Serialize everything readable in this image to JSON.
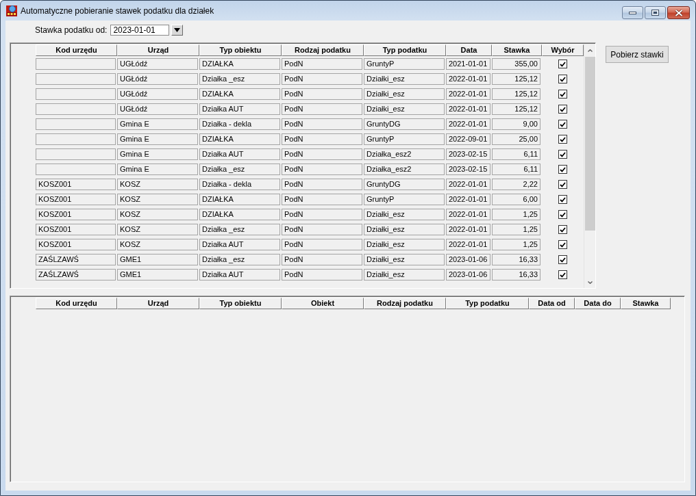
{
  "window": {
    "title": "Automatyczne pobieranie stawek podatku dla działek"
  },
  "filter": {
    "label": "Stawka podatku od:",
    "value": "2023-01-01"
  },
  "rates_table": {
    "columns": [
      "Kod urzędu",
      "Urząd",
      "Typ obiektu",
      "Rodzaj podatku",
      "Typ podatku",
      "Data",
      "Stawka",
      "Wybór"
    ],
    "rows": [
      {
        "office": "UGŁódź",
        "object_type": "DZIAŁKA",
        "tax_kind": "PodN",
        "tax_type": "GruntyP",
        "date": "2021-01-01",
        "rate": "355,00",
        "checked": true
      },
      {
        "office": "UGŁódź",
        "object_type": "Działka _esz",
        "tax_kind": "PodN",
        "tax_type": "Działki_esz",
        "date": "2022-01-01",
        "rate": "125,12",
        "checked": true
      },
      {
        "office": "UGŁódź",
        "object_type": "DZIAŁKA",
        "tax_kind": "PodN",
        "tax_type": "Działki_esz",
        "date": "2022-01-01",
        "rate": "125,12",
        "checked": true
      },
      {
        "office": "UGŁódź",
        "object_type": "Działka AUT",
        "tax_kind": "PodN",
        "tax_type": "Działki_esz",
        "date": "2022-01-01",
        "rate": "125,12",
        "checked": true
      },
      {
        "office": "Gmina E",
        "object_type": "Działka - dekla",
        "tax_kind": "PodN",
        "tax_type": "GruntyDG",
        "date": "2022-01-01",
        "rate": "9,00",
        "checked": true
      },
      {
        "office": "Gmina E",
        "object_type": "DZIAŁKA",
        "tax_kind": "PodN",
        "tax_type": "GruntyP",
        "date": "2022-09-01",
        "rate": "25,00",
        "checked": true
      },
      {
        "office": "Gmina E",
        "object_type": "Działka AUT",
        "tax_kind": "PodN",
        "tax_type": "Działka_esz2",
        "date": "2023-02-15",
        "rate": "6,11",
        "checked": true
      },
      {
        "office": "Gmina E",
        "object_type": "Działka _esz",
        "tax_kind": "PodN",
        "tax_type": "Działka_esz2",
        "date": "2023-02-15",
        "rate": "6,11",
        "checked": true
      },
      {
        "office_code": "KOSZ001",
        "office": "KOSZ",
        "object_type": "Działka - dekla",
        "tax_kind": "PodN",
        "tax_type": "GruntyDG",
        "date": "2022-01-01",
        "rate": "2,22",
        "checked": true
      },
      {
        "office_code": "KOSZ001",
        "office": "KOSZ",
        "object_type": "DZIAŁKA",
        "tax_kind": "PodN",
        "tax_type": "GruntyP",
        "date": "2022-01-01",
        "rate": "6,00",
        "checked": true
      },
      {
        "office_code": "KOSZ001",
        "office": "KOSZ",
        "object_type": "DZIAŁKA",
        "tax_kind": "PodN",
        "tax_type": "Działki_esz",
        "date": "2022-01-01",
        "rate": "1,25",
        "checked": true
      },
      {
        "office_code": "KOSZ001",
        "office": "KOSZ",
        "object_type": "Działka _esz",
        "tax_kind": "PodN",
        "tax_type": "Działki_esz",
        "date": "2022-01-01",
        "rate": "1,25",
        "checked": true
      },
      {
        "office_code": "KOSZ001",
        "office": "KOSZ",
        "object_type": "Działka AUT",
        "tax_kind": "PodN",
        "tax_type": "Działki_esz",
        "date": "2022-01-01",
        "rate": "1,25",
        "checked": true
      },
      {
        "office_code": "ZAŚLZAWŚ",
        "office": "GME1",
        "object_type": "Działka _esz",
        "tax_kind": "PodN",
        "tax_type": "Działki_esz",
        "date": "2023-01-06",
        "rate": "16,33",
        "checked": true
      },
      {
        "office_code": "ZAŚLZAWŚ",
        "office": "GME1",
        "object_type": "Działka AUT",
        "tax_kind": "PodN",
        "tax_type": "Działki_esz",
        "date": "2023-01-06",
        "rate": "16,33",
        "checked": true
      }
    ]
  },
  "fetch_button": {
    "label": "Pobierz stawki"
  },
  "results_table": {
    "columns": [
      "Kod urzędu",
      "Urząd",
      "Typ obiektu",
      "Obiekt",
      "Rodzaj podatku",
      "Typ podatku",
      "Data od",
      "Data do",
      "Stawka"
    ]
  }
}
